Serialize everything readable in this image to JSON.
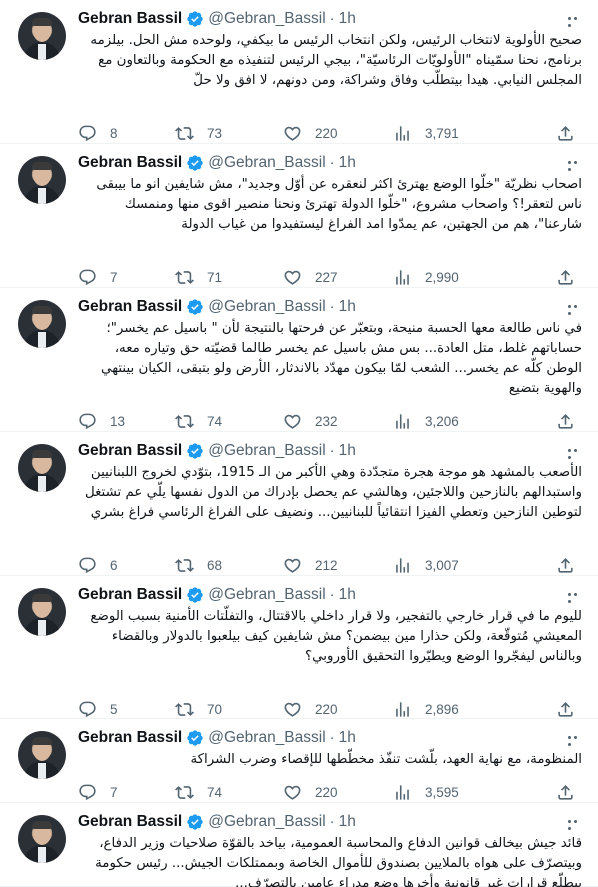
{
  "tweets": [
    {
      "name": "Gebran Bassil",
      "handle": "@Gebran_Bassil",
      "separator": "·",
      "time": "1h",
      "text": "صحيح الأولوية لانتخاب الرئيس، ولكن انتخاب الرئيس ما بيكفي، ولوحده مش الحل. بيلزمه برنامج، نحنا سمّيناه \"الأولويّات الرئاسيّة\"، بيجي الرئيس لتنفيذه مع الحكومة وبالتعاون مع المجلس النيابي. هيدا بيتطلّب وفاق وشراكة، ومن دونهم، لا افق ولا حلّ",
      "replies": "8",
      "retweets": "73",
      "likes": "220",
      "views": "3,791"
    },
    {
      "name": "Gebran Bassil",
      "handle": "@Gebran_Bassil",
      "separator": "·",
      "time": "1h",
      "text": "اصحاب نظريّة \"خلّوا الوضع يهترئ اكثر لنعقره عن أوّل وجديد\"، مش شايفين انو ما بيبقى ناس لتعقر!؟ واصحاب مشروع، \"خلّوا الدولة تهترئ ونحنا منصير اقوى منها ومنمسك شارعنا\"، هم من الجهتين، عم يمدّوا امد الفراغ ليستفيدوا من غياب الدولة",
      "replies": "7",
      "retweets": "71",
      "likes": "227",
      "views": "2,990"
    },
    {
      "name": "Gebran Bassil",
      "handle": "@Gebran_Bassil",
      "separator": "·",
      "time": "1h",
      "text": "في ناس طالعة معها الحسبة منيحة، وبتعبّر عن فرحتها بالنتيجة لأن \" باسيل عم يخسر\"؛ حساباتهم غلط، متل العادة... بس مش باسيل عم يخسر طالما قضيّته حق وتياره معه، الوطن كلّه عم يخسر... الشعب لمّا بيكون مهدّد بالاندثار، الأرض ولو بتبقى، الكيان بينتهي والهوية بتضيع",
      "replies": "13",
      "retweets": "74",
      "likes": "232",
      "views": "3,206"
    },
    {
      "name": "Gebran Bassil",
      "handle": "@Gebran_Bassil",
      "separator": "·",
      "time": "1h",
      "text": "الأصعب بالمشهد هو موجة هجرة متجدّدة وهي الأكبر من الـ 1915، بتوّدي لخروج اللبنانيين واستبدالهم بالنازحين واللاجئين، وهالشي عم يحصل بإدراك من الدول نفسها يلّي عم تشتغل لتوطين النازحين وتعطي الفيزا انتقائياً للبنانيين... ونضيف على الفراغ الرئاسي فراغ بشري",
      "replies": "6",
      "retweets": "68",
      "likes": "212",
      "views": "3,007"
    },
    {
      "name": "Gebran Bassil",
      "handle": "@Gebran_Bassil",
      "separator": "·",
      "time": "1h",
      "text": "لليوم ما في قرار خارجي بالتفجير، ولا قرار داخلي بالاقتتال، والتفلّتات الأمنية بسبب الوضع المعيشي مُتوقّعة، ولكن حذارا مين بيضمن؟ مش شايفين كيف بيلعبوا بالدولار وبالقضاء وبالناس ليفجّروا الوضع ويطيّروا التحقيق الأوروبي؟",
      "replies": "5",
      "retweets": "70",
      "likes": "220",
      "views": "2,896"
    },
    {
      "name": "Gebran Bassil",
      "handle": "@Gebran_Bassil",
      "separator": "·",
      "time": "1h",
      "text": "المنظومة، مع نهاية العهد، بلّشت تنفّذ مخطّطها للإقصاء وضرب الشراكة",
      "replies": "7",
      "retweets": "74",
      "likes": "220",
      "views": "3,595"
    },
    {
      "name": "Gebran Bassil",
      "handle": "@Gebran_Bassil",
      "separator": "·",
      "time": "1h",
      "text": "قائد جيش بيخالف قوانين الدفاع والمحاسبة العمومية، بياخد بالقوّة صلاحيات وزير الدفاع، وبيتصرّف على هواه بالملايين بصندوق للأموال الخاصة وبممتلكات الجيش... رئيس حكومة بيطلّع قرارات غير قانونية وأخرها وضع مدراء عامين بالتصرّف..."
    }
  ]
}
